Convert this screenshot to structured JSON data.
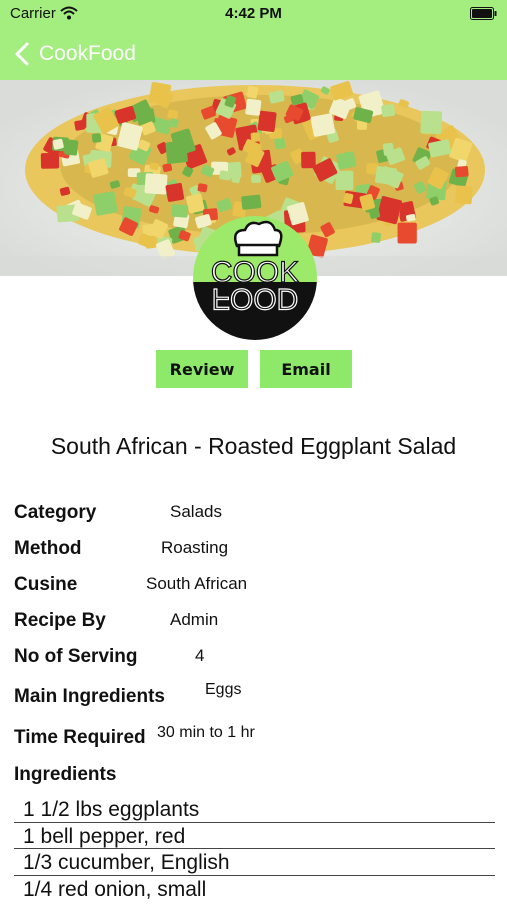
{
  "status_bar": {
    "carrier": "Carrier",
    "time": "4:42 PM"
  },
  "nav": {
    "back_label": "CookFood"
  },
  "logo": {
    "text_top": "COOK",
    "text_bottom": "FOOD"
  },
  "actions": {
    "review_label": "Review",
    "email_label": "Email"
  },
  "recipe": {
    "title": "South African - Roasted Eggplant Salad",
    "details": [
      {
        "label": "Category",
        "value": "Salads"
      },
      {
        "label": "Method",
        "value": "Roasting"
      },
      {
        "label": "Cusine",
        "value": "South African"
      },
      {
        "label": "Recipe By",
        "value": "Admin"
      },
      {
        "label": "No of Serving",
        "value": "4"
      },
      {
        "label": "Main Ingredients",
        "value": "Eggs"
      },
      {
        "label": "Time Required",
        "value": "30 min to 1 hr"
      }
    ],
    "ingredients_label": "Ingredients",
    "ingredients": [
      "1 1/2 lbs eggplants",
      "1 bell pepper, red",
      "1/3 cucumber, English",
      "1/4 red onion, small"
    ]
  },
  "colors": {
    "nav_bar": "#a3ee7f",
    "button": "#8ee86a",
    "logo_green": "#9dea6a"
  }
}
